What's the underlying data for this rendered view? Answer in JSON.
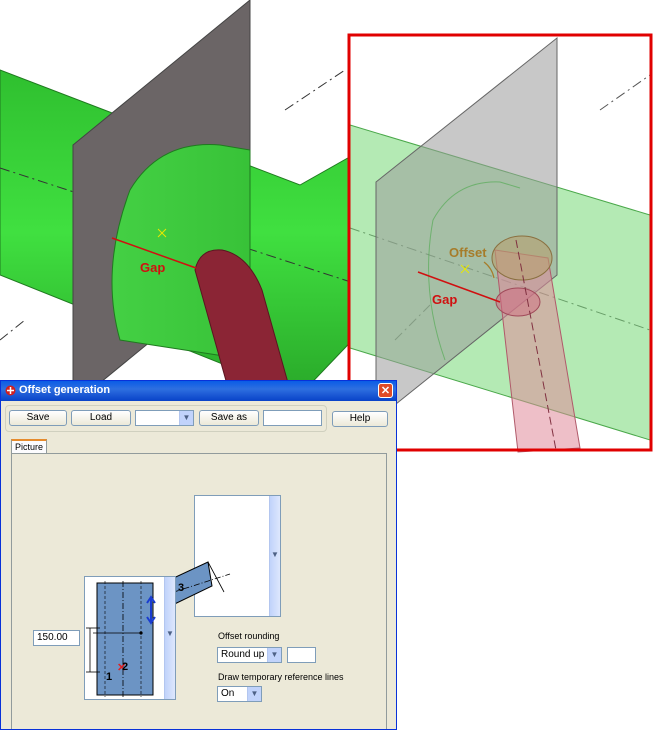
{
  "scene": {
    "left_labels": {
      "gap": "Gap"
    },
    "right_labels": {
      "offset": "Offset",
      "gap": "Gap"
    },
    "colors": {
      "highlight_frame": "#e00000",
      "pipe": "#33cc33",
      "branch": "#8b2535",
      "plate": "#6b6566",
      "dim_line": "#d01010",
      "offset_label": "#a67c2a"
    }
  },
  "dialog": {
    "title": "Offset generation",
    "toolbar": {
      "save_label": "Save",
      "load_label": "Load",
      "preset_value": "",
      "save_as_label": "Save as",
      "save_as_value": "",
      "help_label": "Help"
    },
    "tabs": [
      {
        "label": "Picture"
      }
    ],
    "picture": {
      "input_value": "150.00",
      "num1": "1",
      "num2": "2",
      "num3": "3"
    },
    "offset_rounding": {
      "label": "Offset rounding",
      "value": "Round up",
      "extra_value": ""
    },
    "draw_lines": {
      "label": "Draw temporary reference lines",
      "value": "On"
    }
  }
}
